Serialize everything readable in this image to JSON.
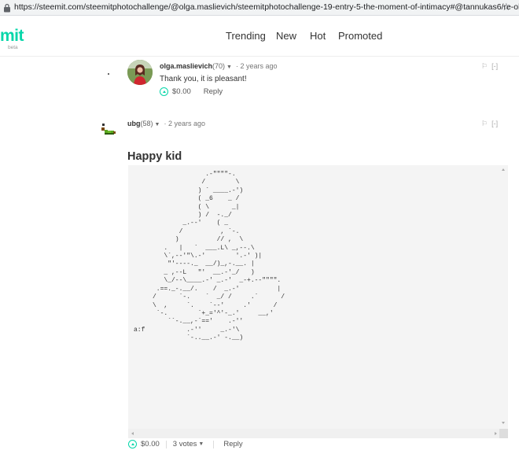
{
  "browser": {
    "url": "https://steemit.com/steemitphotochallenge/@olga.maslievich/steemitphotochallenge-19-entry-5-the-moment-of-intimacy#@tannukas6/re-olgam..."
  },
  "header": {
    "logo": "mit",
    "beta": "beta",
    "nav": [
      "Trending",
      "New",
      "Hot",
      "Promoted"
    ]
  },
  "comments": [
    {
      "author": "olga.maslievich",
      "reputation": "(70)",
      "time": "· 2 years ago",
      "body": "Thank you, it is pleasant!",
      "payout": "$0.00",
      "reply": "Reply",
      "flag": "[-]"
    },
    {
      "author": "ubg",
      "reputation": "(58)",
      "time": "· 2 years ago",
      "title": "Happy kid",
      "ascii_art": "                   .-\"\"\"\"-.\n                  /        \\\n                 ) ` ____.-')\n                 ( _6    _ /\n                 ( \\      _|\n                 ) /  -._/\n             _.--'    ( _\n            /          , `-.\n           )          // ,  \\\n        .   |   `  ___.L\\ _,--.\\\n        \\`,--'\"\\.-'        '.-' )|\n         \"'----._  __/)_,-.__. |\n        _ ,--L   \"'  __.-'_/   )\n        \\_/--\\____.-' _.-'  _-+.--\"\"\"\".\n      .==._-.__/.    /  _.-'          |\n     /      `-.    `  _/ /     .`      /\n     \\  ,     `.    `--'     .'      /\n      `-.        `+_='^'-_.'     __,'\n         ``-.__,-`=='    .-''\na:f           .-''     _.-'\\\n              `-..__.-' -.__)",
      "payout": "$0.00",
      "votes": "3 votes",
      "reply": "Reply",
      "flag": "[-]"
    }
  ],
  "colors": {
    "accent": "#06d6a9"
  }
}
